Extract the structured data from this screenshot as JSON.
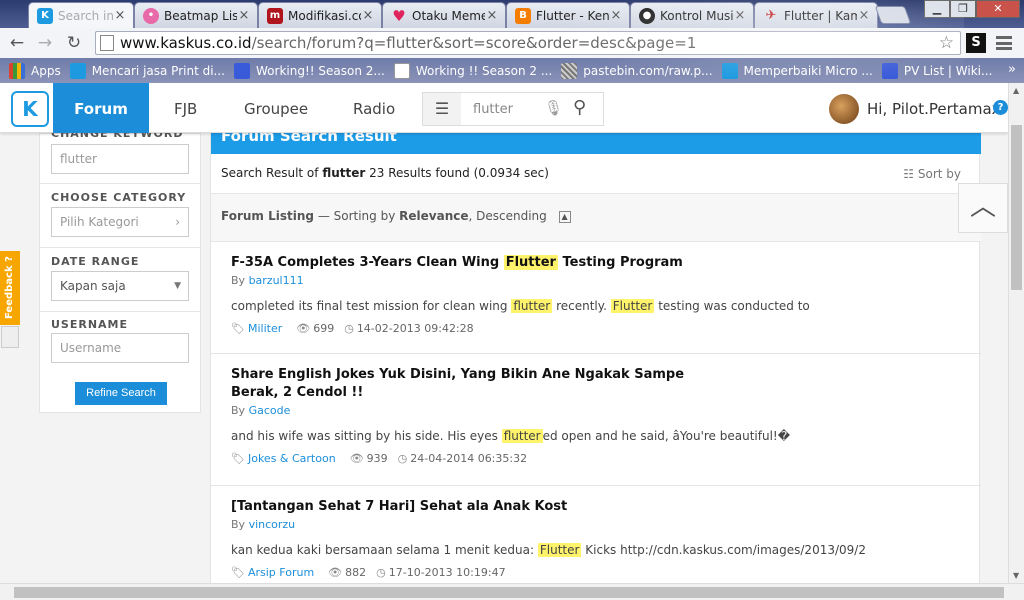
{
  "browser": {
    "tabs": [
      {
        "label": "Search in For",
        "color": "#1e9be0",
        "active": true
      },
      {
        "label": "Beatmap List",
        "color": "#e96aa8"
      },
      {
        "label": "Modifikasi.co",
        "color": "#b0141c"
      },
      {
        "label": "Otaku Meme",
        "color": "#e0245e"
      },
      {
        "label": "Flutter - Kenc",
        "color": "#f57d00"
      },
      {
        "label": "Kontrol Musi",
        "color": "#222222"
      },
      {
        "label": "Flutter | Kam",
        "color": "#c62828"
      }
    ],
    "url_host": "www.kaskus.co.id",
    "url_path": "/search/forum?q=flutter&sort=score&order=desc&page=1",
    "ext_label": "S",
    "bookmarks": [
      {
        "label": "Apps",
        "color": "#d8432f"
      },
      {
        "label": "Mencari jasa Print di...",
        "color": "#1e9be0"
      },
      {
        "label": "Working!! Season 2...",
        "color": "#3a5bd9"
      },
      {
        "label": "Working !! Season 2 ...",
        "color": "#ffffff"
      },
      {
        "label": "pastebin.com/raw.p...",
        "color": "#888888"
      },
      {
        "label": "Memperbaiki Micro ...",
        "color": "#1e9be0"
      },
      {
        "label": "PV List | Wiki...",
        "color": "#3a5bd9"
      }
    ]
  },
  "site": {
    "logo": "K",
    "nav": [
      {
        "label": "Forum",
        "active": true
      },
      {
        "label": "FJB"
      },
      {
        "label": "Groupee"
      },
      {
        "label": "Radio"
      }
    ],
    "search_value": "flutter",
    "user_greeting": "Hi, Pilot.Pertamax",
    "help": "?"
  },
  "sidebar": {
    "keyword_label": "CHANGE KEYWORD",
    "keyword_value": "flutter",
    "category_label": "CHOOSE CATEGORY",
    "category_placeholder": "Pilih Kategori",
    "date_label": "DATE RANGE",
    "date_value": "Kapan saja",
    "username_label": "USERNAME",
    "username_placeholder": "Username",
    "refine_label": "Refine Search"
  },
  "results": {
    "header": "Forum Search Result",
    "info_prefix": "Search Result of",
    "query": "flutter",
    "info_suffix": "23 Results found (0.0934 sec)",
    "sort_label": "Sort by",
    "listing_label": "Forum Listing",
    "sorting_text": "— Sorting by",
    "sorting_key": "Relevance",
    "sorting_order": ", Descending",
    "items": [
      {
        "title_pre": "F-35A Completes 3-Years Clean Wing",
        "title_hl": "Flutter",
        "title_post": "Testing Program",
        "author": "barzul111",
        "snip_a": "completed its final test mission for clean wing",
        "snip_hl1": "flutter",
        "snip_b": "recently.",
        "snip_hl2": "Flutter",
        "snip_c": "testing was conducted to",
        "category": "Militer",
        "views": "699",
        "date": "14-02-2013 09:42:28"
      },
      {
        "title_pre": "Share English Jokes Yuk Disini, Yang Bikin Ane Ngakak Sampe Berak, 2 Cendol !!",
        "title_hl": "",
        "title_post": "",
        "author": "Gacode",
        "snip_a": "and his wife was sitting by his side. His eyes",
        "snip_hl1": "flutter",
        "snip_b": "ed open and he said, âYou're beautiful!�",
        "snip_hl2": "",
        "snip_c": "",
        "category": "Jokes & Cartoon",
        "views": "939",
        "date": "24-04-2014 06:35:32"
      },
      {
        "title_pre": "[Tantangan Sehat 7 Hari] Sehat ala Anak Kost",
        "title_hl": "",
        "title_post": "",
        "author": "vincorzu",
        "snip_a": "kan kedua kaki bersamaan selama 1 menit kedua:",
        "snip_hl1": "Flutter",
        "snip_b": "Kicks http://cdn.kaskus.com/images/2013/09/2",
        "snip_hl2": "",
        "snip_c": "",
        "category": "Arsip Forum",
        "views": "882",
        "date": "17-10-2013 10:19:47"
      }
    ]
  },
  "feedback_label": "Feedback ?"
}
